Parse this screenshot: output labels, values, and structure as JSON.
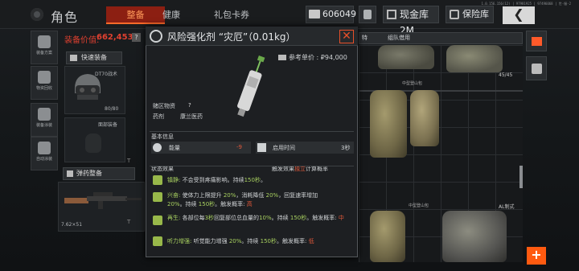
{
  "header": {
    "version": "1.0.156.156(12) | 97981925 | 97496068 | 世-服-2",
    "title": "角色",
    "tabs": [
      "整备",
      "健康",
      "礼包卡券"
    ],
    "money": "606049",
    "cash_btn": "现金库 2M",
    "vault_btn": "保险库",
    "back": "❮"
  },
  "side": {
    "b1": "装备方案",
    "b2": "物资回收",
    "b3": "装备涂装",
    "b4": "自动涂装"
  },
  "loadout": {
    "value_label": "装备价值:",
    "value": "662,453",
    "help": "?",
    "quick_btn": "快速装备",
    "helmet_name": "DT70战术",
    "helmet_dur": "80/80",
    "face_label": "面部装备",
    "ammo_btn": "弹药整备",
    "weapon_cal": "7.62×51",
    "t": "T",
    "t2": "T"
  },
  "inventory": {
    "tab_cut": "特",
    "tab_team": "组队借用",
    "bag_label": "中型登山包",
    "bag_label2": "中型登山包",
    "count": "45/45",
    "al": "AL制式"
  },
  "popup": {
    "title": "风险强化剂 “灾厄”（0.01kg）",
    "close": "✕",
    "price": "参考单价 : ₽94,000",
    "tag1": "赌区物资",
    "tag1_help": "?",
    "tag2": "药剂",
    "tag3": "康兰医药",
    "basic_title": "基本信息",
    "stat1_name": "能量",
    "stat1_val": "-9",
    "stat2_name": "启用时间",
    "stat2_val": "3秒",
    "status_title": "状态效果",
    "status_right_a": "触发效果",
    "status_right_b": "独立",
    "status_right_c": "计算概率",
    "e1_name": "镇静:",
    "e1_text": "不会受到疼痛影响。持续",
    "e1_g": "150秒",
    "e1_end": "。",
    "e2_name": "兴奋:",
    "e2_a": "使体力上限提升",
    "e2_g1": "20%",
    "e2_b": "，消耗降低",
    "e2_g2": "20%",
    "e2_c": "，回复速率增加",
    "e2_g3": "20%",
    "e2_d": "。持续",
    "e2_g4": "150秒",
    "e2_e": "。触发概率:",
    "e2_r": "高",
    "e3_name": "再生:",
    "e3_a": "各部位每",
    "e3_g1": "3秒",
    "e3_b": "回复部位总血量的",
    "e3_g2": "10%",
    "e3_c": "。持续",
    "e3_g3": "150秒",
    "e3_d": "。触发概率:",
    "e3_r": "中",
    "e4_name": "听力增强:",
    "e4_a": "听觉能力增强",
    "e4_g1": "20%",
    "e4_b": "。持续",
    "e4_g2": "150秒",
    "e4_c": "。触发概率:",
    "e4_r": "低"
  },
  "colors": {
    "accent": "#ff5a10",
    "red": "#e0583a",
    "green": "#a8d060"
  }
}
